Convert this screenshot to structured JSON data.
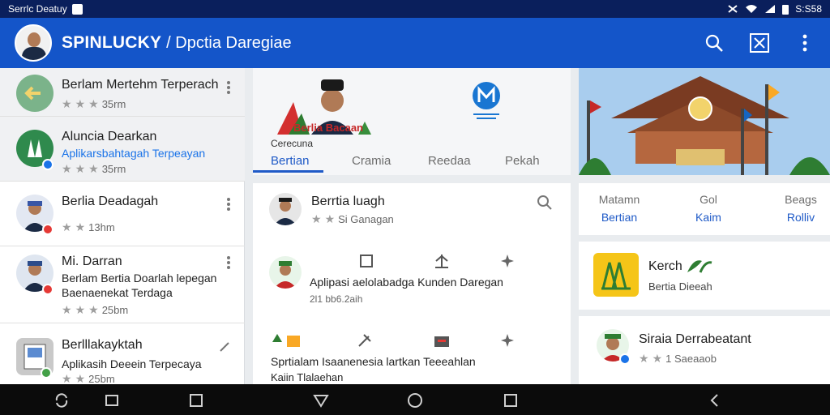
{
  "status_bar": {
    "left_text": "Serrlc Deatuy",
    "right_text": "S:S58"
  },
  "app_bar": {
    "title": "SPINLUCKY",
    "subtitle": "/ Dpctia Daregiae"
  },
  "left_list": {
    "items": [
      {
        "title": "Berlam Mertehm Terperach",
        "meta": "35rm",
        "color": "#7bb38a"
      },
      {
        "title": "Aluncia Dearkan",
        "line2": "Aplikarsbahtagah Terpeayan",
        "meta": "35rm",
        "color": "#2f8a4d"
      },
      {
        "title": "Berlia Deadagah",
        "meta": "13hm",
        "color": "#3856a6"
      },
      {
        "title": "Mi. Darran",
        "line2": "Berlam Bertia Doarlah lepegan",
        "line3": "Baenaenekat Terdaga",
        "meta": "25bm",
        "color": "#2c4c8a"
      },
      {
        "title": "Berlllakayktah",
        "line2": "Aplikasih Deeein Terpecaya",
        "meta": "25bm",
        "color": "#c9c9c9"
      }
    ]
  },
  "banner": {
    "logo_text": "Berlia Bacaan",
    "caption": "Cerecuna"
  },
  "tabs": [
    "Bertian",
    "Cramia",
    "Reedaa",
    "Pekah"
  ],
  "post": {
    "author": "Berrtia luagh",
    "meta": "Si Ganagan",
    "body": "Aplipasi aelolabadga Kunden Daregan",
    "body_meta": "2l1 bb6.2aih",
    "footer": "Sprtialam Isaanenesia lartkan Teeeahlan",
    "footer2": "Kaiin Tlalaehan"
  },
  "stats": [
    {
      "label": "Matamn",
      "value": "Bertian"
    },
    {
      "label": "Gol",
      "value": "Kaim"
    },
    {
      "label": "Beags",
      "value": "Rolliv"
    }
  ],
  "promo": {
    "title": "Kerch",
    "subtitle": "Bertia Dieeah"
  },
  "person": {
    "name": "Siraia Derrabeatant",
    "meta": "1 Saeaaob"
  }
}
